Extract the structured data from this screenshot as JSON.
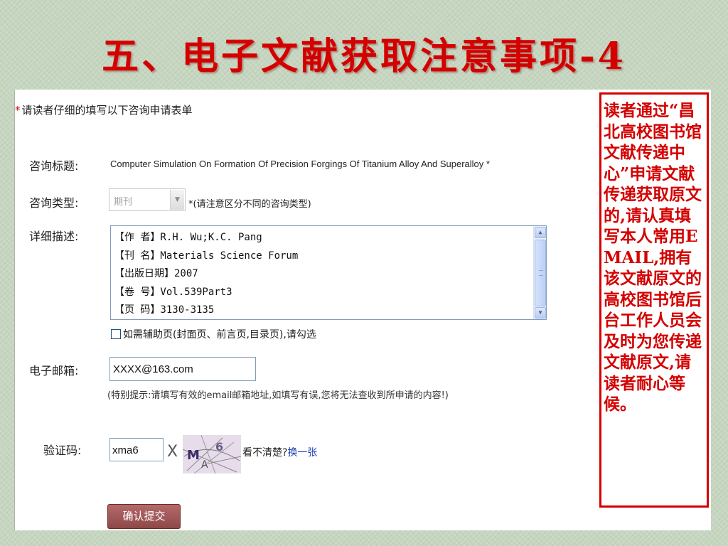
{
  "slide": {
    "title": "五、电子文献获取注意事项-4"
  },
  "form": {
    "heading_star": "*",
    "heading": "请读者仔细的填写以下咨询申请表单",
    "subject_label": "咨询标题:",
    "subject_value": "Computer Simulation On Formation Of Precision Forgings Of Titanium Alloy And Superalloy *",
    "type_label": "咨询类型:",
    "type_selected": "期刊",
    "type_hint": "*(请注意区分不同的咨询类型)",
    "detail_label": "详细描述:",
    "detail_lines": [
      "【作 者】R.H. Wu;K.C. Pang",
      "【刊 名】Materials Science Forum",
      "【出版日期】2007",
      "【卷 号】Vol.539Part3",
      "【页 码】3130-3135"
    ],
    "aux_page_label": "如需辅助页(封面页、前言页,目录页),请勾选",
    "email_label": "电子邮箱:",
    "email_value": "XXXX@163.com",
    "email_note": "(特别提示:请填写有效的email邮箱地址,如填写有误,您将无法查收到所申请的内容!)",
    "captcha_label": "验证码:",
    "captcha_value": "xma6",
    "captcha_image_text": "X M A 6",
    "captcha_unclear": "看不清楚?",
    "captcha_refresh": "换一张",
    "submit_label": "确认提交"
  },
  "note": {
    "text": "读者通过“昌北高校图书馆文献传递中心”申请文献传递获取原文的,请认真填写本人常用EMAIL,拥有该文献原文的高校图书馆后台工作人员会及时为您传递文献原文,请读者耐心等候。"
  },
  "colors": {
    "slide_background": "#c6d6c0",
    "accent_red": "#d40000",
    "submit_button": "#9e5454",
    "link_blue": "#1a3fb0"
  }
}
